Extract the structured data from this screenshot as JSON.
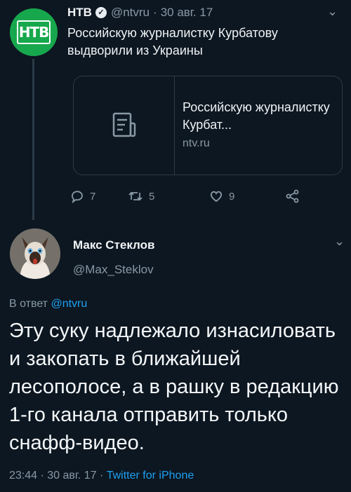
{
  "parent_tweet": {
    "avatar_logo": "НТВ",
    "name": "НТВ",
    "verified_icon": "verified-badge-icon",
    "handle": "@ntvru",
    "separator": "·",
    "date": "30 авг. 17",
    "text": "Российскую журналистку Курбатову выдворили из Украины",
    "link_card": {
      "title": "Российскую журналистку Курбат...",
      "domain": "ntv.ru",
      "thumbnail_icon": "document-icon"
    },
    "actions": {
      "reply_count": "7",
      "retweet_count": "5",
      "like_count": "9"
    }
  },
  "reply_tweet": {
    "name": "Макс Стеклов",
    "handle": "@Max_Steklov",
    "in_reply_prefix": "В ответ",
    "in_reply_mention": "@ntvru",
    "text": "Эту суку надлежало изнасиловать и закопать в ближайшей лесополосе, а в рашку в редакцию 1-го канала отправить только снафф-видео.",
    "time": "23:44",
    "date": "30 авг. 17",
    "separator": "·",
    "source": "Twitter for iPhone"
  },
  "colors": {
    "background": "#0d1721",
    "secondary_text": "#8899a6",
    "link": "#1da1f2",
    "ntv_green": "#17a84d"
  }
}
